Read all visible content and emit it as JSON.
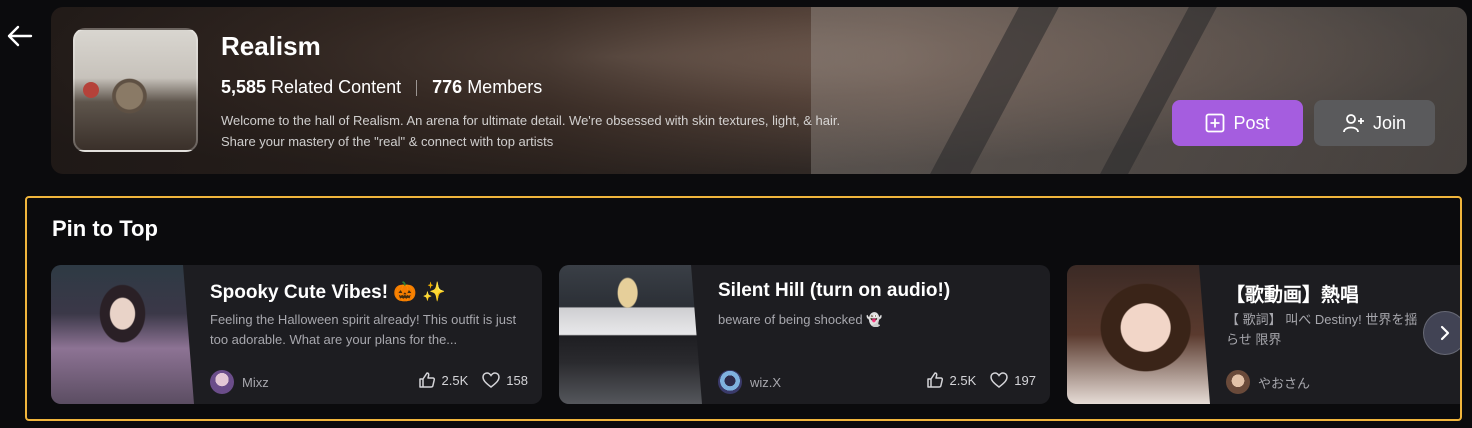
{
  "community": {
    "name": "Realism",
    "related_count": "5,585",
    "related_label": "Related Content",
    "members_count": "776",
    "members_label": "Members",
    "description": "Welcome to the hall of Realism. An arena for ultimate detail. We're obsessed with skin textures, light, & hair. Share your mastery of the \"real\" & connect with top artists"
  },
  "actions": {
    "post_label": "Post",
    "join_label": "Join"
  },
  "pin_section": {
    "title": "Pin to Top",
    "cards": [
      {
        "title": "Spooky Cute Vibes! 🎃 ✨",
        "desc": "Feeling the Halloween spirit already! This outfit is just too adorable. What are your plans for the...",
        "author": "Mixz",
        "likes": "2.5K",
        "favs": "158"
      },
      {
        "title": "Silent Hill (turn on audio!)",
        "desc": "beware of being shocked 👻",
        "author": "wiz.X",
        "likes": "2.5K",
        "favs": "197"
      },
      {
        "title": "【歌動画】熱唱",
        "desc": "【 歌詞】 叫べ Destiny!  世界を揺らせ 限界",
        "author": "やおさん",
        "likes": "",
        "favs": ""
      }
    ]
  },
  "colors": {
    "accent": "#a55ddf",
    "highlight_border": "#f0b53c",
    "card_bg": "#1d1d21"
  }
}
